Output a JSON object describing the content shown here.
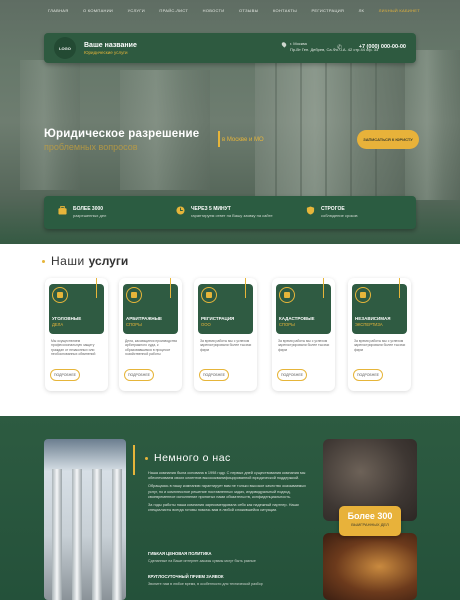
{
  "nav": {
    "items": [
      "Главная",
      "О компании",
      "Услуги",
      "Прайс-лист",
      "Новости",
      "Отзывы",
      "Контакты",
      "Регистрация",
      "ЛК"
    ],
    "account_link": "Личный кабинет"
  },
  "header": {
    "logo_text": "LOGO",
    "name": "Ваше название",
    "subtitle": "Юридические услуги",
    "address": "г. Москва\nПр-Вт Ген. Дебрев, Са.Фо.Ч.А. 42 стр.44 оф. 33",
    "phone": "+7 (000) 000-00-00"
  },
  "hero": {
    "title": "Юридическое разрешение",
    "subtitle": "проблемных вопросов",
    "location": "в Москве и МО",
    "cta_label": "Записаться к юристу"
  },
  "features": [
    {
      "title": "Более 3000",
      "desc": "разрешенных дел"
    },
    {
      "title": "Через 5 минут",
      "desc": "гарантируем ответ на Вашу заявку на сайте"
    },
    {
      "title": "Строгое",
      "desc": "соблюдение сроков"
    }
  ],
  "services": {
    "heading_light": "Наши",
    "heading_bold": "услуги",
    "cards": [
      {
        "title": "Уголовные",
        "sub": "дела",
        "desc": "Мы осуществляем профессиональную защиту граждан от незаконных или необоснованных обвинений",
        "button": "Подробнее"
      },
      {
        "title": "Арбитражные",
        "sub": "споры",
        "desc": "Дела, касающиеся производства арбитражного суда, к образовавшимся в процессе хозяйственной работы",
        "button": "Подробнее"
      },
      {
        "title": "Регистрация",
        "sub": "ООО",
        "desc": "За время работы мы с успехом зарегистрировали более тысячи фирм",
        "button": "Подробнее"
      },
      {
        "title": "Кадастровые",
        "sub": "споры",
        "desc": "За время работы мы с успехом зарегистрировали более тысячи фирм",
        "button": "Подробнее"
      },
      {
        "title": "Независимая",
        "sub": "экспертиза",
        "desc": "За время работы мы с успехом зарегистрировали более тысячи фирм",
        "button": "Подробнее"
      }
    ]
  },
  "about": {
    "heading": "Немного о нас",
    "p1": "Наша компания была основана в 1998 году. С первых дней существования компания мы обеспечиваем своих клиентов высококвалифицированной юридической поддержкой.",
    "p2": "Обращаясь в нашу компанию гарантирует вам не только высокое качество оказываемых услуг, но и комплексное решение поставленных задач, индивидуальный подход, своевременное исполнение принятых нами обязательств, конфиденциальность.",
    "p3": "За годы работы наша компания зарекомендовала себя как надежный партнер. Наши специалисты всегда готовы помочь вам в любой сложившейся ситуации.",
    "points": [
      {
        "title": "Гибкая ценовая политика",
        "desc": "Сделанные на Ваше интернет-заказы суммы могут быть разные"
      },
      {
        "title": "Круглосуточный прием заявок",
        "desc": "Звоните нам в любое время, в особенности для технической разбор"
      }
    ],
    "badge_number": "Более 300",
    "badge_desc": "выигранных дел"
  }
}
